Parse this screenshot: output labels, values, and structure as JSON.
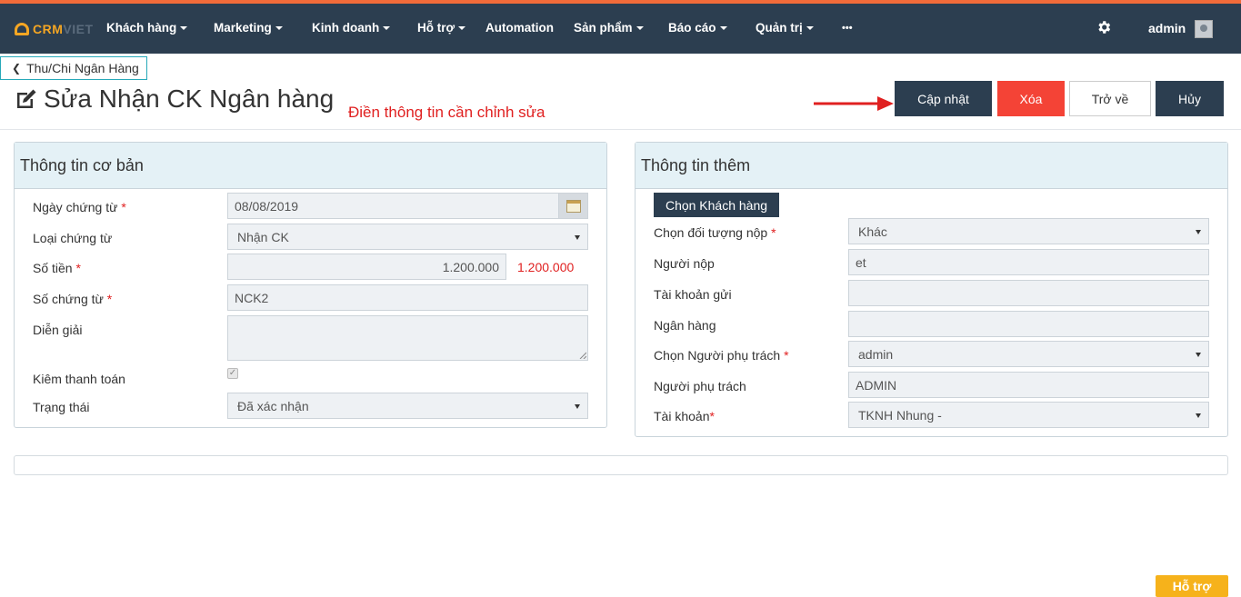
{
  "colors": {
    "navbar": "#2c3e50",
    "accent": "#f26b3a",
    "danger": "#f44336",
    "panel_header": "#e4f1f6",
    "help": "#f6b21b"
  },
  "logo": {
    "text_primary": "CRM",
    "text_secondary": "VIET"
  },
  "nav": {
    "items": [
      "Khách hàng",
      "Marketing",
      "Kinh doanh",
      "Hỗ trợ",
      "Automation",
      "Sản phẩm",
      "Báo cáo",
      "Quản trị",
      "•••"
    ],
    "settings_icon": "gear-icon",
    "user": "admin"
  },
  "back_link": "Thu/Chi Ngân Hàng",
  "page_title": "Sửa Nhận CK Ngân hàng",
  "hint": "Điền thông tin cần chỉnh sửa",
  "actions": {
    "update": "Cập nhật",
    "delete": "Xóa",
    "back": "Trở về",
    "cancel": "Hủy"
  },
  "basic": {
    "title": "Thông tin cơ bản",
    "date_label": "Ngày chứng từ",
    "date_value": "08/08/2019",
    "type_label": "Loại chứng từ",
    "type_value": "Nhận CK",
    "amount_label": "Số tiền",
    "amount_value": "1.200.000",
    "amount_display": "1.200.000",
    "doc_no_label": "Số chứng từ",
    "doc_no_value": "NCK2",
    "desc_label": "Diễn giải",
    "desc_value": "",
    "payment_label": "Kiêm thanh toán",
    "payment_checked": true,
    "status_label": "Trạng thái",
    "status_value": "Đã xác nhận",
    "required_mark": "*"
  },
  "extra": {
    "title": "Thông tin thêm",
    "choose_customer": "Chọn Khách hàng",
    "payer_type_label": "Chọn đối tượng nộp",
    "payer_type_value": "Khác",
    "payer_label": "Người nộp",
    "payer_value": "et",
    "account_send_label": "Tài khoản gửi",
    "account_send_value": "",
    "bank_label": "Ngân hàng",
    "bank_value": "",
    "owner_select_label": "Chọn Người phụ trách",
    "owner_select_value": "admin",
    "owner_label": "Người phụ trách",
    "owner_value": "ADMIN",
    "account_label": "Tài khoản",
    "account_value": "TKNH Nhung -",
    "required_mark": "*"
  },
  "help": "Hỗ trợ"
}
